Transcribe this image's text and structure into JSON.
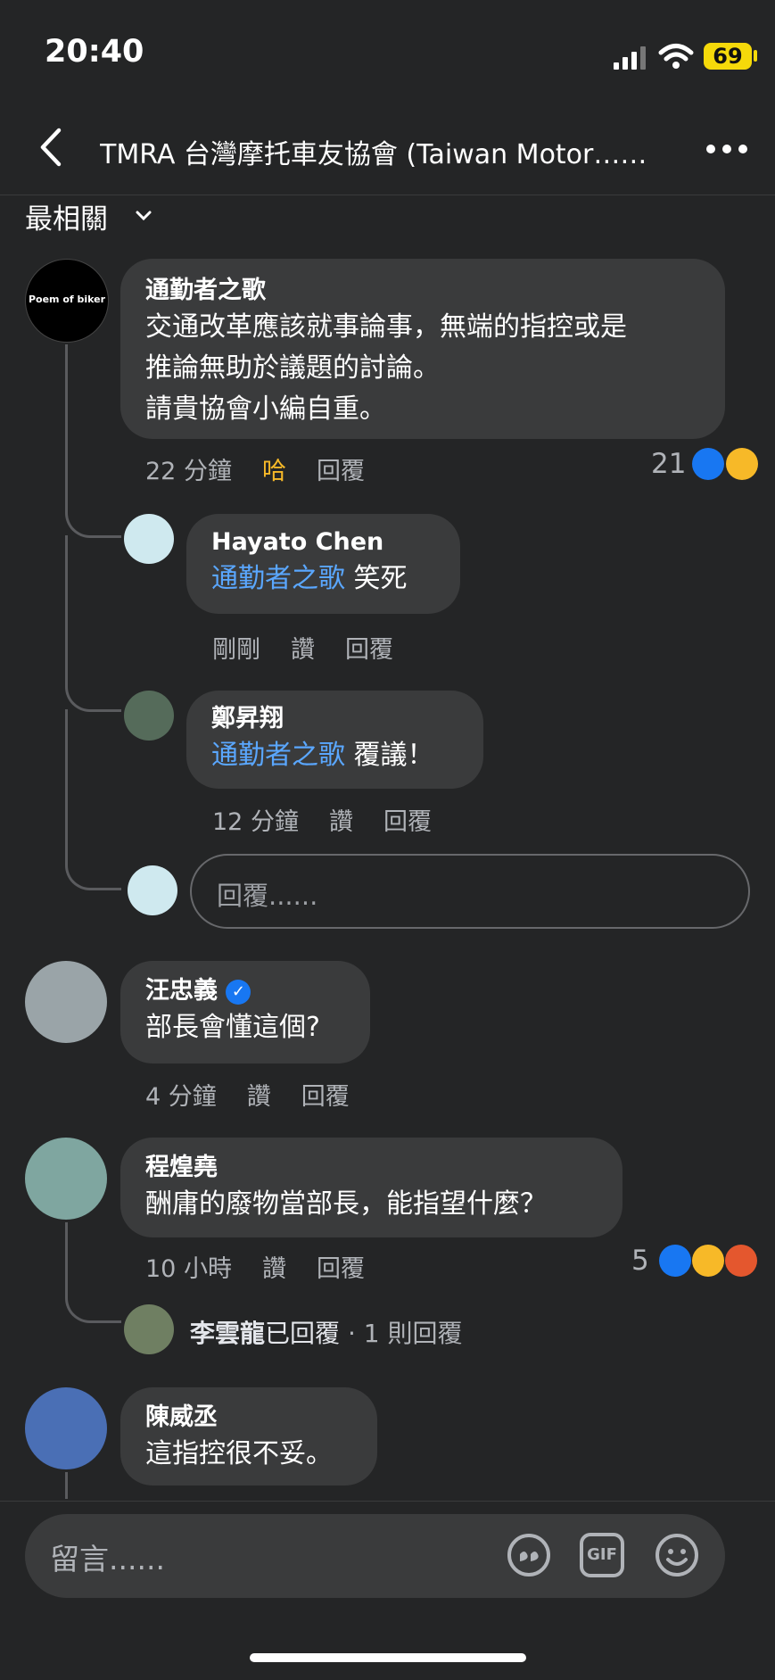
{
  "status": {
    "time": "20:40",
    "battery": "69"
  },
  "header": {
    "title": "TMRA 台灣摩托車友協會 (Taiwan Motor……"
  },
  "sort": {
    "label": "最相關"
  },
  "comments": [
    {
      "name": "通勤者之歌",
      "avatar_text": "Poem of biker",
      "lines": [
        "交通改革應該就事論事，無端的指控或是",
        "推論無助於議題的討論。",
        "請貴協會小編自重。"
      ],
      "time": "22 分鐘",
      "reaction": "哈",
      "reply": "回覆",
      "count": "21",
      "replies": [
        {
          "name": "Hayato Chen",
          "mention": "通勤者之歌",
          "text": "笑死",
          "time": "剛剛",
          "like": "讚",
          "reply": "回覆"
        },
        {
          "name": "鄭昇翔",
          "mention": "通勤者之歌",
          "text": "覆議！",
          "time": "12 分鐘",
          "like": "讚",
          "reply": "回覆"
        }
      ],
      "reply_placeholder": "回覆......"
    },
    {
      "name": "汪忠義",
      "text": "部長會懂這個?",
      "time": "4 分鐘",
      "like": "讚",
      "reply": "回覆"
    },
    {
      "name": "程煌堯",
      "text": "酬庸的廢物當部長，能指望什麼？",
      "time": "10 小時",
      "like": "讚",
      "reply": "回覆",
      "count": "5",
      "thread_name": "李雲龍",
      "thread_replied": "已回覆",
      "thread_count": "· 1 則回覆"
    },
    {
      "name": "陳威丞",
      "text": "這指控很不妥。"
    }
  ],
  "composer": {
    "placeholder": "留言......",
    "gif": "GIF"
  },
  "colors": {
    "background": "#242526",
    "bubble": "#3a3b3c",
    "mention": "#5aa7ff",
    "like": "#1877f2",
    "haha": "#f7b928"
  }
}
